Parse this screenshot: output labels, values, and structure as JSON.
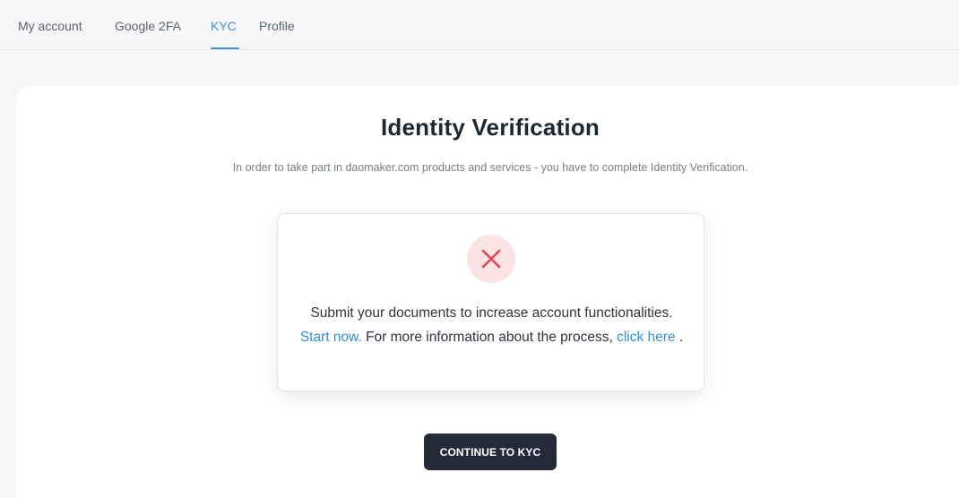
{
  "tabs": [
    {
      "label": "My account",
      "active": false
    },
    {
      "label": "Google 2FA",
      "active": false
    },
    {
      "label": "KYC",
      "active": true
    },
    {
      "label": "Profile",
      "active": false
    }
  ],
  "main": {
    "title": "Identity Verification",
    "subtitle": "In order to take part in daomaker.com products and services - you have to complete Identity Verification.",
    "status": {
      "icon": "close-icon",
      "text_part1": "Submit your documents to increase account functionalities.",
      "link_start": "Start now.",
      "text_part2": "For more information about the process,",
      "link_more": "click here",
      "text_end": "."
    },
    "cta_label": "CONTINUE TO KYC"
  },
  "colors": {
    "accent": "#3a8fd9",
    "link": "#2e8ee0",
    "error": "#e0474c",
    "error_bg": "#fbe3e3",
    "button_bg": "#242a3a"
  }
}
